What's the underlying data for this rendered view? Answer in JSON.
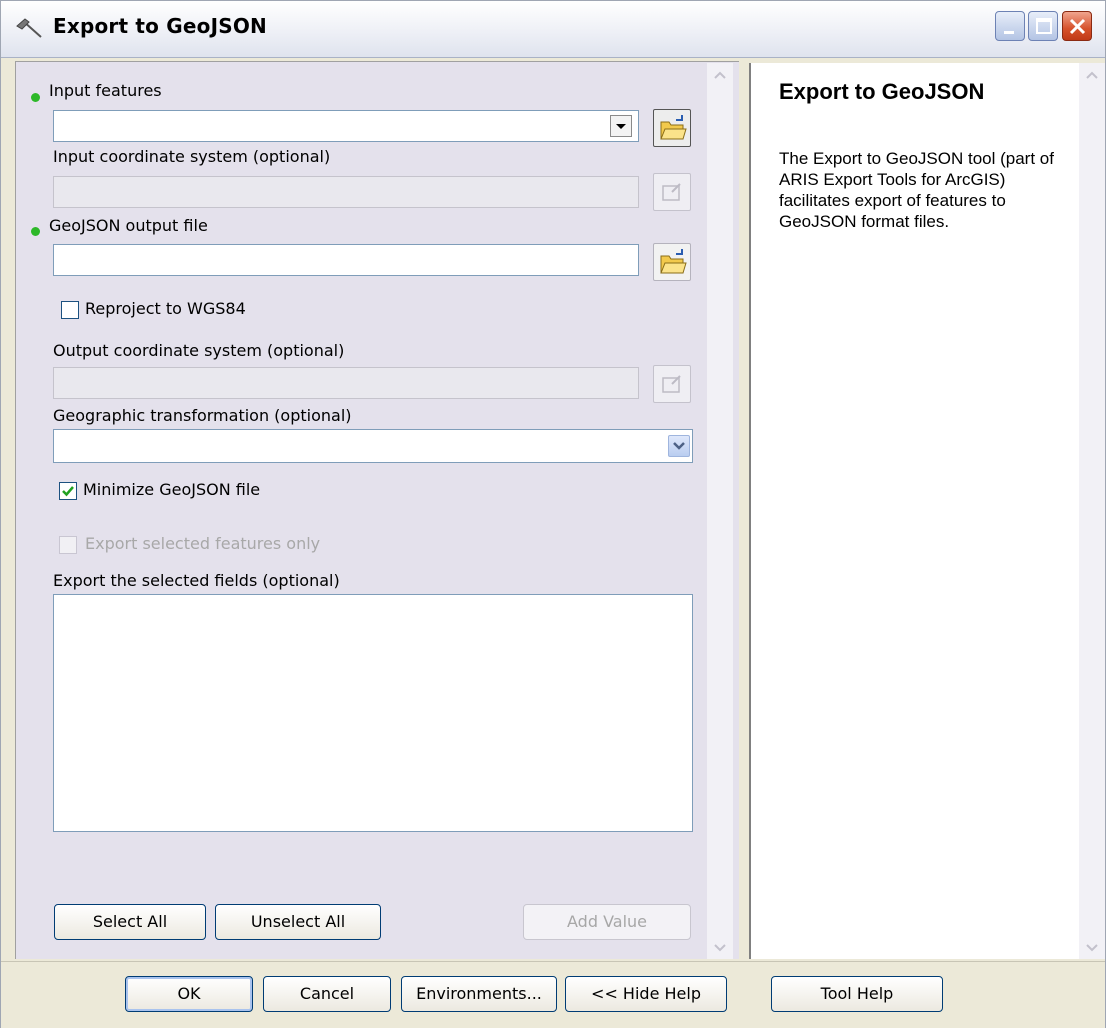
{
  "window": {
    "title": "Export to GeoJSON",
    "title_icon": "hammer-icon",
    "controls": [
      "minimize-icon",
      "maximize-icon",
      "close-icon"
    ]
  },
  "form": {
    "input_features": {
      "label": "Input features",
      "value": "",
      "required": true
    },
    "input_coord_system": {
      "label": "Input coordinate system (optional)",
      "value": ""
    },
    "output_file": {
      "label": "GeoJSON output file",
      "value": "",
      "required": true
    },
    "reproject": {
      "label": "Reproject to WGS84",
      "checked": false
    },
    "output_coord_system": {
      "label": "Output coordinate system (optional)",
      "value": ""
    },
    "geo_transformation": {
      "label": "Geographic transformation (optional)",
      "value": ""
    },
    "minimize": {
      "label": "Minimize GeoJSON file",
      "checked": true
    },
    "selected_only": {
      "label": "Export selected features only",
      "checked": false,
      "enabled": false
    },
    "fields": {
      "label": "Export the selected fields (optional)",
      "items": []
    }
  },
  "field_buttons": {
    "select_all": "Select All",
    "unselect_all": "Unselect All",
    "add_value": "Add Value"
  },
  "help": {
    "title": "Export to GeoJSON",
    "body": "The Export to GeoJSON tool (part of ARIS Export Tools for ArcGIS) facilitates export of features to GeoJSON format files."
  },
  "footer": {
    "ok": "OK",
    "cancel": "Cancel",
    "environments": "Environments...",
    "hide_help": "<< Hide Help",
    "tool_help": "Tool Help"
  },
  "colors": {
    "required_dot": "#2db829",
    "form_bg": "#e4e1ec",
    "frame_bg": "#ece9d8",
    "field_border": "#7f9db9"
  }
}
